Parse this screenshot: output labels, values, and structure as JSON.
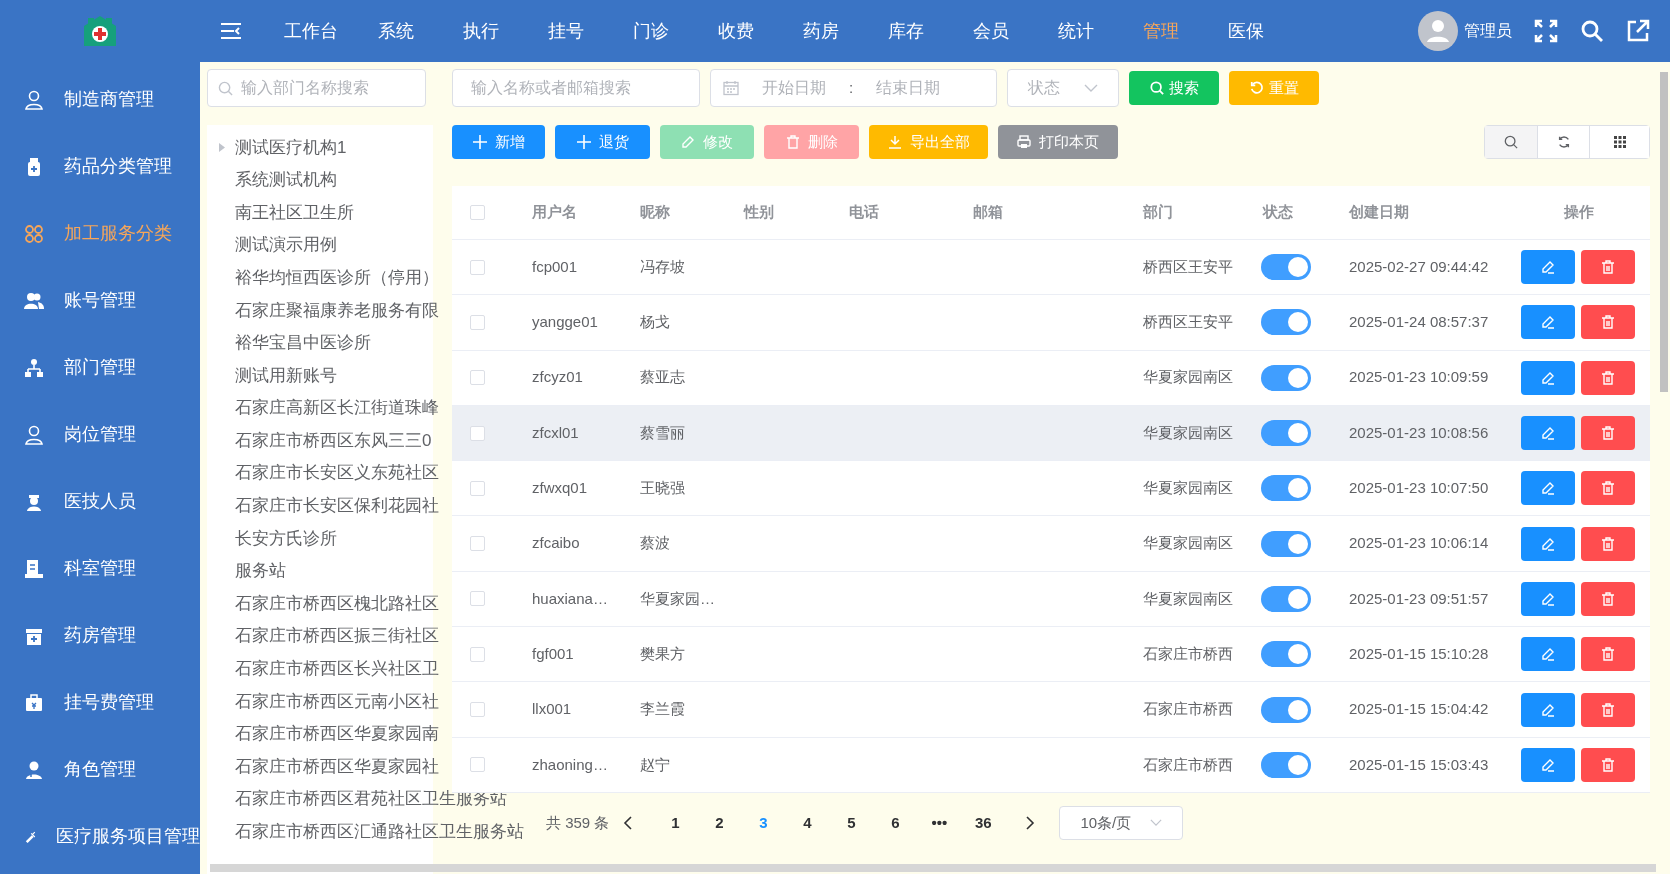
{
  "top_nav": {
    "items": [
      {
        "label": "工作台",
        "selected": false
      },
      {
        "label": "系统",
        "selected": false
      },
      {
        "label": "执行",
        "selected": false
      },
      {
        "label": "挂号",
        "selected": false
      },
      {
        "label": "门诊",
        "selected": false
      },
      {
        "label": "收费",
        "selected": false
      },
      {
        "label": "药房",
        "selected": false
      },
      {
        "label": "库存",
        "selected": false
      },
      {
        "label": "会员",
        "selected": false
      },
      {
        "label": "统计",
        "selected": false
      },
      {
        "label": "管理",
        "selected": true
      },
      {
        "label": "医保",
        "selected": false
      }
    ],
    "user": "管理员"
  },
  "sidebar": {
    "items": [
      {
        "label": "制造商管理",
        "selected": false
      },
      {
        "label": "药品分类管理",
        "selected": false
      },
      {
        "label": "加工服务分类",
        "selected": true
      },
      {
        "label": "账号管理",
        "selected": false
      },
      {
        "label": "部门管理",
        "selected": false
      },
      {
        "label": "岗位管理",
        "selected": false
      },
      {
        "label": "医技人员",
        "selected": false
      },
      {
        "label": "科室管理",
        "selected": false
      },
      {
        "label": "药房管理",
        "selected": false
      },
      {
        "label": "挂号费管理",
        "selected": false
      },
      {
        "label": "角色管理",
        "selected": false
      },
      {
        "label": "医疗服务项目管理",
        "selected": false
      }
    ]
  },
  "dept_tree": {
    "search_placeholder": "输入部门名称搜索",
    "items": [
      {
        "label": "测试医疗机构1",
        "expandable": true
      },
      {
        "label": "系统测试机构",
        "expandable": false
      },
      {
        "label": "南王社区卫生所",
        "expandable": false
      },
      {
        "label": "测试演示用例",
        "expandable": false
      },
      {
        "label": "裕华均恒西医诊所（停用）",
        "expandable": false
      },
      {
        "label": "石家庄聚福康养老服务有限",
        "expandable": false
      },
      {
        "label": "裕华宝昌中医诊所",
        "expandable": false
      },
      {
        "label": "测试用新账号",
        "expandable": false
      },
      {
        "label": "石家庄高新区长江街道珠峰",
        "expandable": false
      },
      {
        "label": "石家庄市桥西区东风三三0",
        "expandable": false
      },
      {
        "label": "石家庄市长安区义东苑社区",
        "expandable": false
      },
      {
        "label": "石家庄市长安区保利花园社",
        "expandable": false
      },
      {
        "label": "长安方氏诊所",
        "expandable": false
      },
      {
        "label": "服务站",
        "expandable": false
      },
      {
        "label": "石家庄市桥西区槐北路社区",
        "expandable": false
      },
      {
        "label": "石家庄市桥西区振三街社区",
        "expandable": false
      },
      {
        "label": "石家庄市桥西区长兴社区卫",
        "expandable": false
      },
      {
        "label": "石家庄市桥西区元南小区社",
        "expandable": false
      },
      {
        "label": "石家庄市桥西区华夏家园南",
        "expandable": false
      },
      {
        "label": "石家庄市桥西区华夏家园社",
        "expandable": false
      },
      {
        "label": "石家庄市桥西区君苑社区卫生服务站",
        "expandable": false
      },
      {
        "label": "石家庄市桥西区汇通路社区卫生服务站",
        "expandable": false
      }
    ]
  },
  "filters": {
    "name_placeholder": "输入名称或者邮箱搜索",
    "start_placeholder": "开始日期",
    "separator": ":",
    "end_placeholder": "结束日期",
    "status_placeholder": "状态",
    "search": "搜索",
    "reset": "重置"
  },
  "actions": [
    {
      "kind": "add",
      "label": "新增",
      "disabled": false
    },
    {
      "kind": "return",
      "label": "退货",
      "disabled": false
    },
    {
      "kind": "edit",
      "label": "修改",
      "disabled": true
    },
    {
      "kind": "delete",
      "label": "删除",
      "disabled": true
    },
    {
      "kind": "export",
      "label": "导出全部",
      "disabled": false
    },
    {
      "kind": "print",
      "label": "打印本页",
      "disabled": false
    }
  ],
  "table": {
    "columns": [
      "用户名",
      "昵称",
      "性别",
      "电话",
      "邮箱",
      "部门",
      "状态",
      "创建日期",
      "操作"
    ],
    "header_checked": false,
    "rows": [
      {
        "username": "fcp001",
        "nickname": "冯存坡",
        "dept": "桥西区王安平",
        "on": true,
        "created": "2025-02-27 09:44:42",
        "checked": false,
        "highlighted": false
      },
      {
        "username": "yangge01",
        "nickname": "杨戈",
        "dept": "桥西区王安平",
        "on": true,
        "created": "2025-01-24 08:57:37",
        "checked": false,
        "highlighted": false
      },
      {
        "username": "zfcyz01",
        "nickname": "蔡亚志",
        "dept": "华夏家园南区",
        "on": true,
        "created": "2025-01-23 10:09:59",
        "checked": false,
        "highlighted": false
      },
      {
        "username": "zfcxl01",
        "nickname": "蔡雪丽",
        "dept": "华夏家园南区",
        "on": true,
        "created": "2025-01-23 10:08:56",
        "checked": false,
        "highlighted": true
      },
      {
        "username": "zfwxq01",
        "nickname": "王晓强",
        "dept": "华夏家园南区",
        "on": true,
        "created": "2025-01-23 10:07:50",
        "checked": false,
        "highlighted": false
      },
      {
        "username": "zfcaibo",
        "nickname": "蔡波",
        "dept": "华夏家园南区",
        "on": true,
        "created": "2025-01-23 10:06:14",
        "checked": false,
        "highlighted": false
      },
      {
        "username": "huaxiana…",
        "nickname": "华夏家园…",
        "dept": "华夏家园南区",
        "on": true,
        "created": "2025-01-23 09:51:57",
        "checked": false,
        "highlighted": false
      },
      {
        "username": "fgf001",
        "nickname": "樊果方",
        "dept": "石家庄市桥西",
        "on": true,
        "created": "2025-01-15 15:10:28",
        "checked": false,
        "highlighted": false
      },
      {
        "username": "llx001",
        "nickname": "李兰霞",
        "dept": "石家庄市桥西",
        "on": true,
        "created": "2025-01-15 15:04:42",
        "checked": false,
        "highlighted": false
      },
      {
        "username": "zhaoning…",
        "nickname": "赵宁",
        "dept": "石家庄市桥西",
        "on": true,
        "created": "2025-01-15 15:03:43",
        "checked": false,
        "highlighted": false
      }
    ]
  },
  "pagination": {
    "total": "共 359 条",
    "pages": [
      {
        "label": "1",
        "selected": false
      },
      {
        "label": "2",
        "selected": false
      },
      {
        "label": "3",
        "selected": true
      },
      {
        "label": "4",
        "selected": false
      },
      {
        "label": "5",
        "selected": false
      },
      {
        "label": "6",
        "selected": false
      },
      {
        "label": "•••",
        "selected": false
      },
      {
        "label": "36",
        "selected": false
      }
    ],
    "page_size": "10条/页"
  }
}
